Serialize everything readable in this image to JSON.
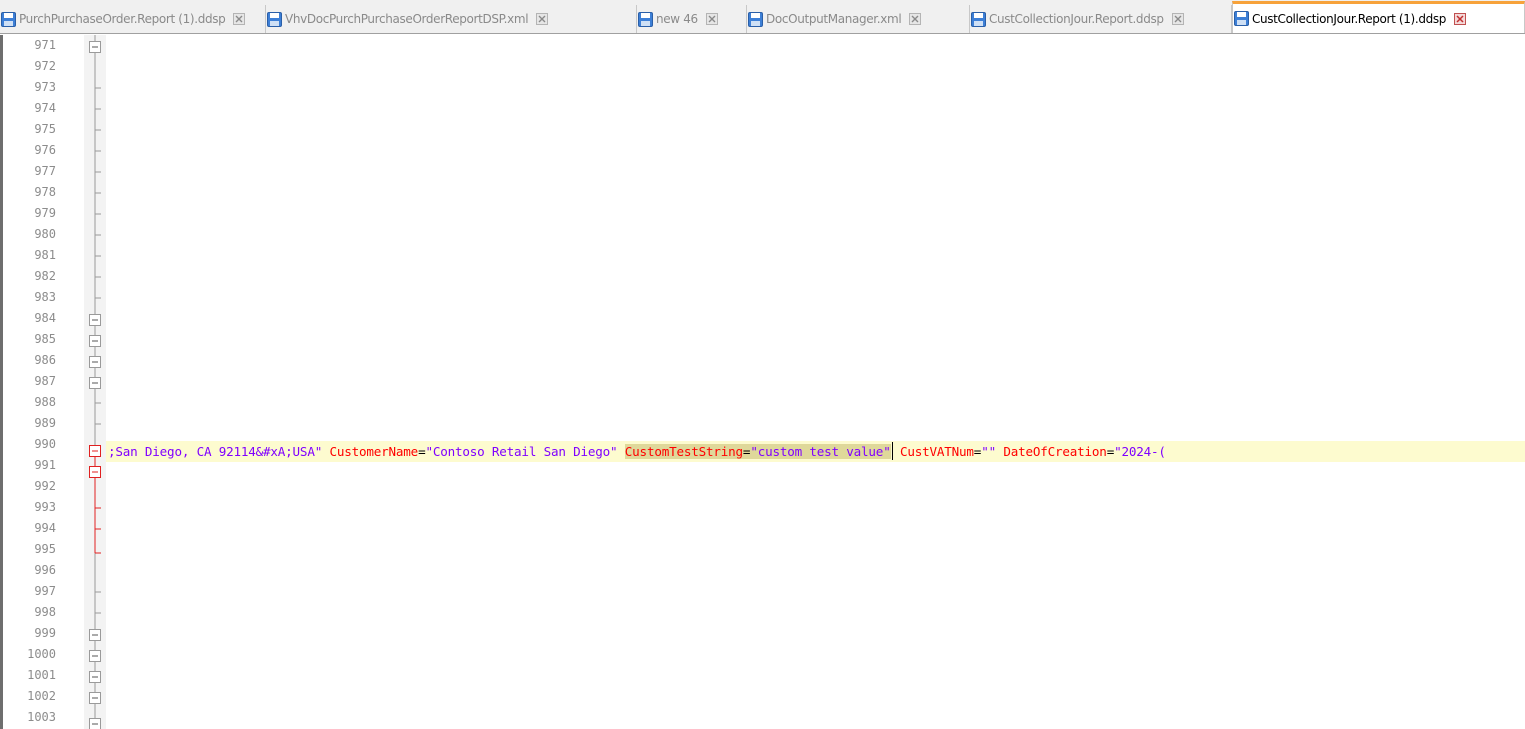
{
  "tabs": [
    {
      "label": "PurchPurchaseOrder.Report (1).ddsp",
      "active": false
    },
    {
      "label": "VhvDocPurchPurchaseOrderReportDSP.xml",
      "active": false
    },
    {
      "label": "new 46",
      "active": false
    },
    {
      "label": "DocOutputManager.xml",
      "active": false
    },
    {
      "label": "CustCollectionJour.Report.ddsp",
      "active": false
    },
    {
      "label": "CustCollectionJour.Report (1).ddsp",
      "active": true
    }
  ],
  "editor": {
    "line_numbers": [
      "971",
      "972",
      "973",
      "974",
      "975",
      "976",
      "977",
      "978",
      "979",
      "980",
      "981",
      "982",
      "983",
      "984",
      "985",
      "986",
      "987",
      "988",
      "989",
      "990",
      "991",
      "992",
      "993",
      "994",
      "995",
      "996",
      "997",
      "998",
      "999",
      "1000",
      "1001",
      "1002",
      "1003"
    ],
    "current_line": "990",
    "code": {
      "seg1": ";San Diego, CA 92114&#xA;USA\"",
      "attr1": "CustomerName",
      "eq1": "=",
      "val1": "\"Contoso Retail San Diego\"",
      "attr2": "CustomTestString",
      "eq2": "=",
      "val2": "\"custom test value\"",
      "attr3": "CustVATNum",
      "eq3": "=",
      "val3": "\"\"",
      "attr4": "DateOfCreation",
      "eq4": "=",
      "val4": "\"2024-("
    }
  },
  "colors": {
    "accent_tab": "#f7a23a",
    "attribute": "#ff0000",
    "value": "#8000ff",
    "current_line_bg": "#fdfbcf",
    "selection_bg": "#dfd89a",
    "fold_error_line": "#e02020"
  },
  "icons": {
    "tab_icon": "save-icon",
    "tab_close": "close-icon",
    "fold_box": "fold-minus-icon"
  }
}
